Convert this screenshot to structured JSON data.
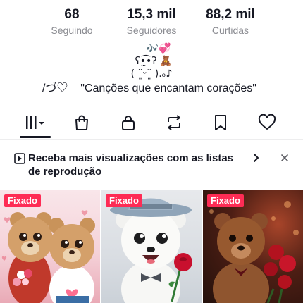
{
  "profile": {
    "stats": [
      {
        "value": "68",
        "label": "Seguindo"
      },
      {
        "value": "15,3 mil",
        "label": "Seguidores"
      },
      {
        "value": "88,2 mil",
        "label": "Curtidas"
      }
    ],
    "bio": {
      "line1": "🎶💞",
      "line2": "ʕ•̫͡•ʔ 🧸",
      "line3": "( ˘͈ᵕ˘͈ ).ₒ♪",
      "line4": "/づ♡    \"Canções que encantam corações\""
    }
  },
  "tabs": {
    "items": [
      {
        "icon": "grid-icon",
        "active": true
      },
      {
        "icon": "shopping-bag-icon",
        "active": false
      },
      {
        "icon": "lock-icon",
        "active": false
      },
      {
        "icon": "repost-icon",
        "active": false
      },
      {
        "icon": "bookmark-icon",
        "active": false
      },
      {
        "icon": "heart-icon",
        "active": false
      }
    ]
  },
  "banner": {
    "icon": "playlist-icon",
    "text": "Receba mais visualizações com as listas de reprodução"
  },
  "videos": [
    {
      "badge": "Fixado",
      "thumbnail": "teddy-bears-couple"
    },
    {
      "badge": "Fixado",
      "thumbnail": "polar-bear-with-rose"
    },
    {
      "badge": "Fixado",
      "thumbnail": "teddy-bear-with-roses"
    }
  ],
  "colors": {
    "text": "#161823",
    "secondary": "#8a8b91",
    "badge": "#fe2c55"
  }
}
